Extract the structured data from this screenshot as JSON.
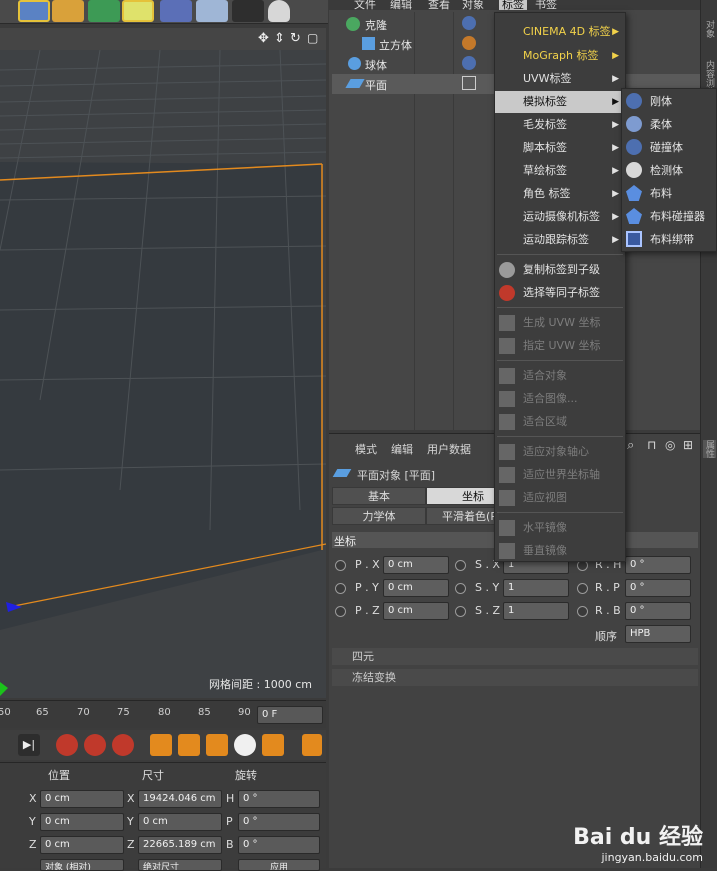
{
  "viewport": {
    "grid_label": "网格间距 : 1000 cm",
    "header_icons": [
      "move-view-icon",
      "zoom-view-icon",
      "rotate-view-icon",
      "maximize-view-icon"
    ]
  },
  "timeline": {
    "ticks": [
      "50",
      "65",
      "70",
      "75",
      "80",
      "85",
      "90"
    ],
    "frame": "0 F"
  },
  "coord": {
    "position_header": "位置",
    "size_header": "尺寸",
    "rotation_header": "旋转",
    "pos": [
      {
        "axis": "X",
        "value": "0 cm"
      },
      {
        "axis": "Y",
        "value": "0 cm"
      },
      {
        "axis": "Z",
        "value": "0 cm"
      }
    ],
    "size": [
      {
        "axis": "X",
        "value": "19424.046 cm"
      },
      {
        "axis": "Y",
        "value": "0 cm"
      },
      {
        "axis": "Z",
        "value": "22665.189 cm"
      }
    ],
    "rot": [
      {
        "axis": "H",
        "value": "0 °"
      },
      {
        "axis": "P",
        "value": "0 °"
      },
      {
        "axis": "B",
        "value": "0 °"
      }
    ],
    "object_mode": "对象 (相对)",
    "size_mode": "绝对尺寸",
    "apply": "应用"
  },
  "menubar": [
    "文件",
    "编辑",
    "查看",
    "对象",
    "标签",
    "书签"
  ],
  "objects": [
    {
      "name": "克隆",
      "indent": 0
    },
    {
      "name": "立方体",
      "indent": 1
    },
    {
      "name": "球体",
      "indent": 0
    },
    {
      "name": "平面",
      "indent": 0
    }
  ],
  "attr": {
    "menu": [
      "模式",
      "编辑",
      "用户数据"
    ],
    "object_title": "平面对象 [平面]",
    "tabs_row1": [
      "基本",
      "坐标"
    ],
    "tabs_row2": [
      "力学体",
      "平滑着色(Ph"
    ],
    "section_title": "坐标",
    "pos": [
      {
        "label": "P . X",
        "value": "0 cm"
      },
      {
        "label": "P . Y",
        "value": "0 cm"
      },
      {
        "label": "P . Z",
        "value": "0 cm"
      }
    ],
    "scale": [
      {
        "label": "S . X",
        "value": "1"
      },
      {
        "label": "S . Y",
        "value": "1"
      },
      {
        "label": "S . Z",
        "value": "1"
      }
    ],
    "rot": [
      {
        "label": "R . H",
        "value": "0 °"
      },
      {
        "label": "R . P",
        "value": "0 °"
      },
      {
        "label": "R . B",
        "value": "0 °"
      }
    ],
    "order_label": "顺序",
    "order_value": "HPB",
    "quaternion": "四元",
    "freeze": "冻结变换"
  },
  "dropdown": {
    "items": [
      {
        "label": "CINEMA 4D 标签",
        "style": "yellow",
        "sub": true
      },
      {
        "label": "MoGraph 标签",
        "style": "yellow",
        "sub": true
      },
      {
        "label": "UVW标签",
        "style": "normal",
        "sub": true
      },
      {
        "label": "模拟标签",
        "style": "highlight",
        "sub": true
      },
      {
        "label": "毛发标签",
        "style": "normal",
        "sub": true
      },
      {
        "label": "脚本标签",
        "style": "normal",
        "sub": true
      },
      {
        "label": "草绘标签",
        "style": "normal",
        "sub": true
      },
      {
        "label": "角色 标签",
        "style": "normal",
        "sub": true
      },
      {
        "label": "运动摄像机标签",
        "style": "normal",
        "sub": true
      },
      {
        "label": "运动跟踪标签",
        "style": "normal",
        "sub": true
      }
    ],
    "actions": [
      {
        "label": "复制标签到子级",
        "style": "normal"
      },
      {
        "label": "选择等同子标签",
        "style": "normal"
      }
    ],
    "uvw": [
      {
        "label": "生成 UVW 坐标",
        "style": "disabled"
      },
      {
        "label": "指定 UVW 坐标",
        "style": "disabled"
      }
    ],
    "fit": [
      {
        "label": "适合对象",
        "style": "disabled"
      },
      {
        "label": "适合图像...",
        "style": "disabled"
      },
      {
        "label": "适合区域",
        "style": "disabled"
      }
    ],
    "align": [
      {
        "label": "适应对象轴心",
        "style": "disabled"
      },
      {
        "label": "适应世界坐标轴",
        "style": "disabled"
      },
      {
        "label": "适应视图",
        "style": "disabled"
      }
    ],
    "mirror": [
      {
        "label": "水平镜像",
        "style": "disabled"
      },
      {
        "label": "垂直镜像",
        "style": "disabled"
      }
    ]
  },
  "submenu": {
    "items": [
      {
        "label": "刚体",
        "icon": "rigid-body-icon"
      },
      {
        "label": "柔体",
        "icon": "soft-body-icon"
      },
      {
        "label": "碰撞体",
        "icon": "collider-body-icon"
      },
      {
        "label": "检测体",
        "icon": "ghost-body-icon"
      },
      {
        "label": "布料",
        "icon": "cloth-icon"
      },
      {
        "label": "布料碰撞器",
        "icon": "cloth-collider-icon"
      },
      {
        "label": "布料绑带",
        "icon": "cloth-belt-icon"
      }
    ]
  },
  "rightstrip": [
    "对象",
    "内容浏览器",
    "属性"
  ],
  "watermark": {
    "brand": "Bai du 经验",
    "url": "jingyan.baidu.com"
  },
  "colors": {
    "accent_orange": "#e38a1e",
    "highlight": "#c9c9c9",
    "disabled": "#7d7d7d",
    "yellow": "#f2d24a"
  }
}
